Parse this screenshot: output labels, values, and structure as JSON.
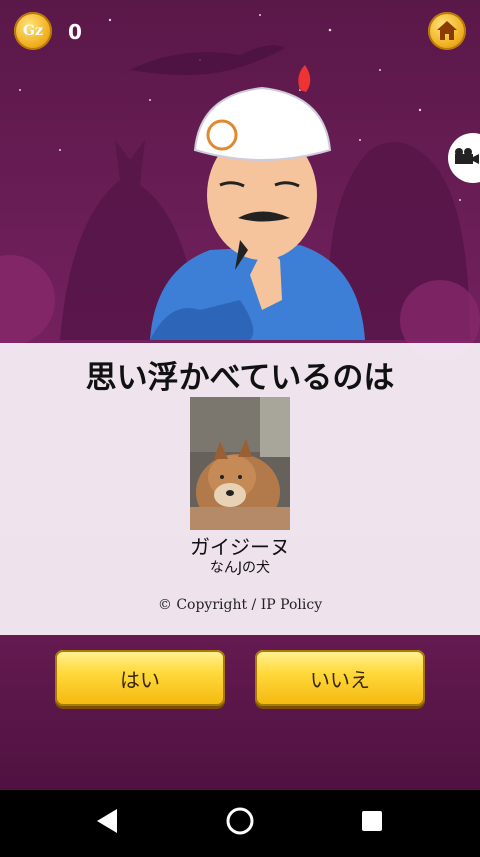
{
  "header": {
    "coin_label": "Gz",
    "coin_count": "0",
    "home_icon": "home-icon",
    "video_icon": "video-camera-icon"
  },
  "guess": {
    "title": "思い浮かべているのは",
    "name": "ガイジーヌ",
    "description": "なんJの犬",
    "copyright": "© Copyright / IP Policy"
  },
  "buttons": {
    "yes": "はい",
    "no": "いいえ"
  },
  "navbar": {
    "back_icon": "back-triangle-icon",
    "home_icon": "home-circle-icon",
    "recents_icon": "recents-square-icon"
  },
  "colors": {
    "background": "#6e1f5a",
    "button_yellow": "#ffd93c",
    "panel": "#f6f0f6"
  }
}
